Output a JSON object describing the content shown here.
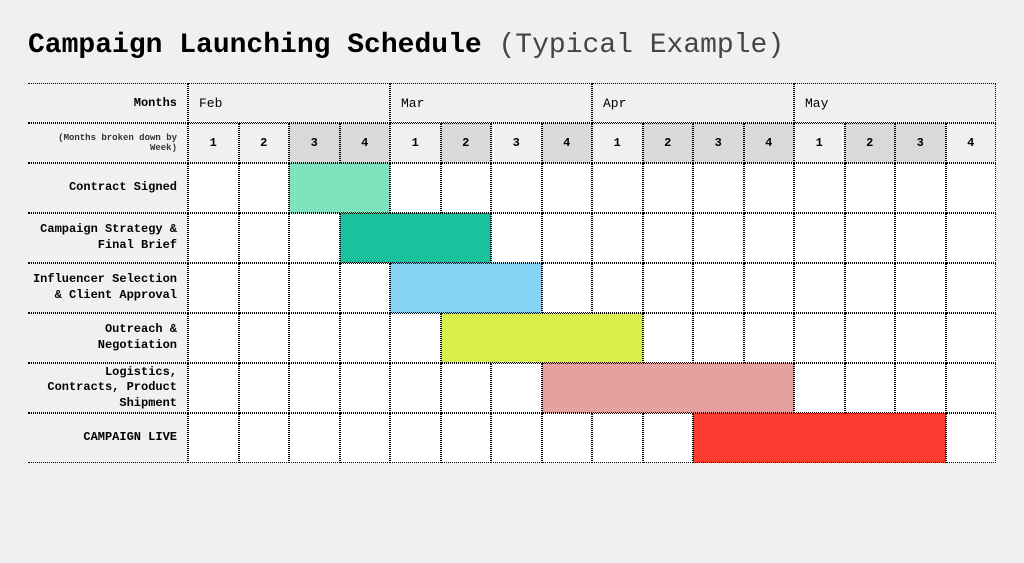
{
  "title_main": "Campaign Launching Schedule",
  "title_sub": "(Typical Example)",
  "months_label": "Months",
  "weeks_label": "(Months broken down by Week)",
  "months": [
    "Feb",
    "Mar",
    "Apr",
    "May"
  ],
  "weeks": [
    "1",
    "2",
    "3",
    "4",
    "1",
    "2",
    "3",
    "4",
    "1",
    "2",
    "3",
    "4",
    "1",
    "2",
    "3",
    "4"
  ],
  "week_shaded": [
    false,
    false,
    true,
    true,
    false,
    true,
    false,
    true,
    false,
    true,
    true,
    true,
    false,
    true,
    true,
    false
  ],
  "tasks": [
    {
      "label": "Contract Signed",
      "start": 3,
      "span": 2,
      "color": "#7fe4bd"
    },
    {
      "label": "Campaign Strategy & Final Brief",
      "start": 4,
      "span": 3,
      "color": "#19c29d"
    },
    {
      "label": "Influencer Selection & Client Approval",
      "start": 5,
      "span": 3,
      "color": "#87d3f3"
    },
    {
      "label": "Outreach & Negotiation",
      "start": 6,
      "span": 4,
      "color": "#d9ed4b"
    },
    {
      "label": "Logistics, Contracts, Product Shipment",
      "start": 8,
      "span": 5,
      "color": "#e6a0a0"
    },
    {
      "label": "CAMPAIGN LIVE",
      "start": 11,
      "span": 5,
      "color": "#fb3b2f"
    }
  ],
  "chart_data": {
    "type": "bar",
    "title": "Campaign Launching Schedule (Typical Example)",
    "xlabel": "Months broken down by Week",
    "x_categories_months": [
      "Feb",
      "Feb",
      "Feb",
      "Feb",
      "Mar",
      "Mar",
      "Mar",
      "Mar",
      "Apr",
      "Apr",
      "Apr",
      "Apr",
      "May",
      "May",
      "May",
      "May"
    ],
    "x_categories_weeks": [
      1,
      2,
      3,
      4,
      1,
      2,
      3,
      4,
      1,
      2,
      3,
      4,
      1,
      2,
      3,
      4
    ],
    "series": [
      {
        "name": "Contract Signed",
        "start_week_index": 3,
        "end_week_index": 4,
        "color": "#7fe4bd"
      },
      {
        "name": "Campaign Strategy & Final Brief",
        "start_week_index": 4,
        "end_week_index": 6,
        "color": "#19c29d"
      },
      {
        "name": "Influencer Selection & Client Approval",
        "start_week_index": 5,
        "end_week_index": 7,
        "color": "#87d3f3"
      },
      {
        "name": "Outreach & Negotiation",
        "start_week_index": 6,
        "end_week_index": 9,
        "color": "#d9ed4b"
      },
      {
        "name": "Logistics, Contracts, Product Shipment",
        "start_week_index": 8,
        "end_week_index": 12,
        "color": "#e6a0a0"
      },
      {
        "name": "CAMPAIGN LIVE",
        "start_week_index": 11,
        "end_week_index": 15,
        "color": "#fb3b2f"
      }
    ]
  }
}
